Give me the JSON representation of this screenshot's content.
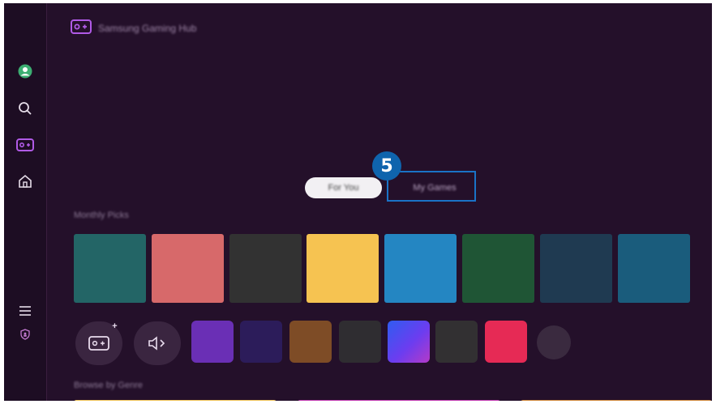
{
  "header": {
    "brand_name": "Samsung Gaming Hub"
  },
  "tabs": [
    {
      "label": "For You",
      "active": true
    },
    {
      "label": "My Games",
      "active": false
    }
  ],
  "step_badge": "5",
  "sections": {
    "monthly_picks": "Monthly Picks",
    "browse_by_genre": "Browse by Genre"
  },
  "sidebar": {
    "items": [
      "profile",
      "search",
      "gaming-hub",
      "home",
      "menu",
      "privacy"
    ]
  },
  "colors": {
    "accent_focus": "#1a73c7",
    "gaming_icon": "#a04fd6",
    "tiles": [
      "#236566",
      "#d7696a",
      "#323232",
      "#f6c351",
      "#2486c2",
      "#1f5535",
      "#1f3a51",
      "#1a5c7c"
    ],
    "apps": [
      "#6a2fb5",
      "#2c1c5a",
      "#7e4c26",
      "#2f2d31",
      "gradient-blue-violet",
      "#323032",
      "#e62a55"
    ]
  }
}
